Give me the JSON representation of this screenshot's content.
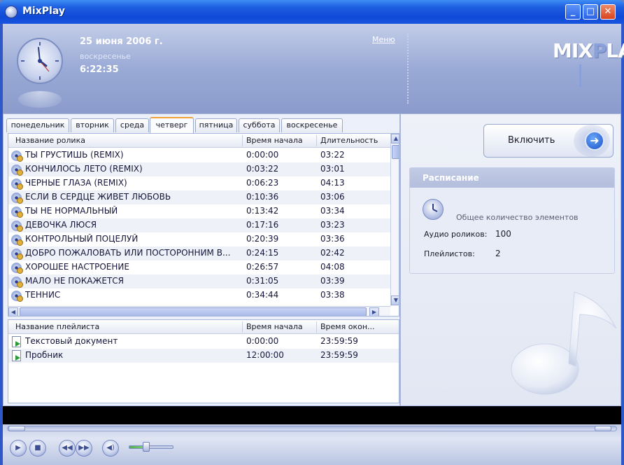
{
  "window": {
    "title": "MixPlay"
  },
  "header": {
    "date": "25 июня 2006 г.",
    "weekday": "воскресенье",
    "time": "6:22:35",
    "menu_label": "Меню",
    "logo": "MIXPLAY"
  },
  "tabs": [
    "понедельник",
    "вторник",
    "среда",
    "четверг",
    "пятница",
    "суббота",
    "воскресенье"
  ],
  "active_tab": "четверг",
  "videos": {
    "columns": [
      "Название ролика",
      "Время начала",
      "Длительность"
    ],
    "rows": [
      {
        "name": "ТЫ ГРУСТИШЬ (REMIX)",
        "start": "0:00:00",
        "duration": "03:22"
      },
      {
        "name": "КОНЧИЛОСЬ ЛЕТО (REMIX)",
        "start": "0:03:22",
        "duration": "03:01"
      },
      {
        "name": "ЧЕРНЫЕ ГЛАЗА (REMIX)",
        "start": "0:06:23",
        "duration": "04:13"
      },
      {
        "name": "ЕСЛИ В СЕРДЦЕ ЖИВЕТ ЛЮБОВЬ",
        "start": "0:10:36",
        "duration": "03:06"
      },
      {
        "name": "ТЫ НЕ НОРМАЛЬНЫЙ",
        "start": "0:13:42",
        "duration": "03:34"
      },
      {
        "name": "ДЕВОЧКА ЛЮСЯ",
        "start": "0:17:16",
        "duration": "03:23"
      },
      {
        "name": "КОНТРОЛЬНЫЙ ПОЦЕЛУЙ",
        "start": "0:20:39",
        "duration": "03:36"
      },
      {
        "name": "ДОБРО ПОЖАЛОВАТЬ ИЛИ ПОСТОРОННИМ В...",
        "start": "0:24:15",
        "duration": "02:42"
      },
      {
        "name": "ХОРОШЕЕ НАСТРОЕНИЕ",
        "start": "0:26:57",
        "duration": "04:08"
      },
      {
        "name": "МАЛО НЕ ПОКАЖЕТСЯ",
        "start": "0:31:05",
        "duration": "03:39"
      },
      {
        "name": "ТЕННИС",
        "start": "0:34:44",
        "duration": "03:38"
      }
    ]
  },
  "playlists": {
    "columns": [
      "Название плейлиста",
      "Время начала",
      "Время окон..."
    ],
    "rows": [
      {
        "name": "Текстовый документ",
        "start": "0:00:00",
        "end": "23:59:59"
      },
      {
        "name": "Пробник",
        "start": "12:00:00",
        "end": "23:59:59"
      }
    ]
  },
  "enable_button": {
    "label": "Включить"
  },
  "schedule": {
    "title": "Расписание",
    "total_label": "Общее количество элементов",
    "audio_label": "Аудио роликов:",
    "audio_value": "100",
    "playlists_label": "Плейлистов:",
    "playlists_value": "2"
  },
  "icons": {
    "clock": "clock-icon",
    "video_row": "disc-icon",
    "playlist_row": "playlist-file-icon",
    "enable": "arrow-right-icon",
    "schedule": "schedule-clock-icon",
    "decor": "music-note-icon"
  },
  "colors": {
    "titlebar": "#1f5fe0",
    "active_tab_accent": "#f0a238",
    "header": "#9aaad6"
  }
}
